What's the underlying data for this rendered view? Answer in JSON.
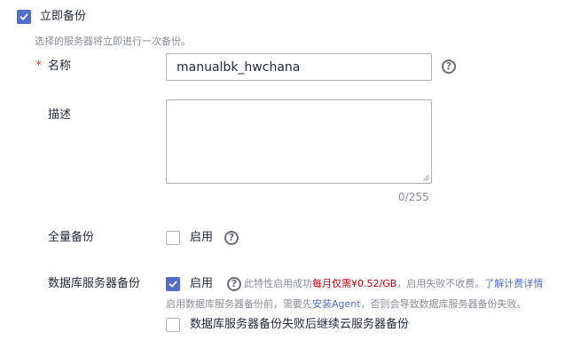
{
  "immediate_backup": {
    "checked": true,
    "label": "立即备份",
    "description": "选择的服务器将立即进行一次备份。"
  },
  "name_field": {
    "required_mark": "*",
    "label": "名称",
    "value": "manualbk_hwchana",
    "help_icon": "help-icon"
  },
  "description_field": {
    "label": "描述",
    "value": "",
    "counter": "0/255"
  },
  "full_backup": {
    "label": "全量备份",
    "checkbox_label": "启用",
    "checked": false,
    "help_icon": "help-icon"
  },
  "db_backup": {
    "label": "数据库服务器备份",
    "checkbox_label": "启用",
    "checked": true,
    "help_icon": "help-icon",
    "note_prefix": "此特性启用成功",
    "note_price": "每月仅需¥0.52/GB",
    "note_suffix": "，启用失败不收费。",
    "note_link": "了解计费详情",
    "agent_prefix": "启用数据库服务器备份前，需要先",
    "agent_link": "安装Agent",
    "agent_suffix": "，否则会导致数据库服务器备份失败。",
    "fallback_label": "数据库服务器备份失败后继续云服务器备份",
    "fallback_checked": false
  },
  "colors": {
    "accent": "#526ecc",
    "required": "#e53935",
    "price": "#c7000b",
    "link": "#526ecc",
    "muted": "#8a8e99"
  }
}
